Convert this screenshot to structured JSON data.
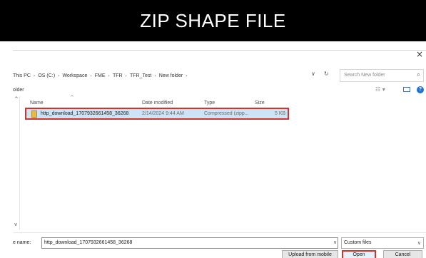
{
  "banner": {
    "title": "ZIP SHAPE FILE"
  },
  "dialog": {
    "close_glyph": "×",
    "breadcrumb": [
      "This PC",
      "OS (C:)",
      "Workspace",
      "FME",
      "TFR",
      "TFR_Test",
      "New folder"
    ],
    "breadcrumb_sep": "›",
    "dropdown_glyph": "∨",
    "refresh_glyph": "↻",
    "search_placeholder": "Search New folder",
    "search_icon_glyph": "⌕",
    "toolbar_label": "older",
    "view_glyph": "☷ ▾",
    "help_glyph": "?",
    "columns": {
      "name": "Name",
      "date": "Date modified",
      "type": "Type",
      "size": "Size"
    },
    "sort_glyph": "^",
    "scroll_up_glyph": "^",
    "scroll_down_glyph": "v",
    "files": [
      {
        "name": "http_download_1707932661458_36268",
        "date": "2/14/2024 9:44 AM",
        "type": "Compressed (zipp...",
        "size": "5 KB"
      }
    ],
    "file_name_label": "e name:",
    "file_name_value": "http_download_1707932661458_36268",
    "file_name_dropdown_glyph": "∨",
    "filter_value": "Custom files",
    "filter_caret_glyph": "∨",
    "buttons": {
      "upload": "Upload from mobile",
      "open": "Open",
      "cancel": "Cancel"
    }
  },
  "colors": {
    "highlight": "#d0342c",
    "selection": "#cce4f7",
    "help": "#1e73d8"
  }
}
